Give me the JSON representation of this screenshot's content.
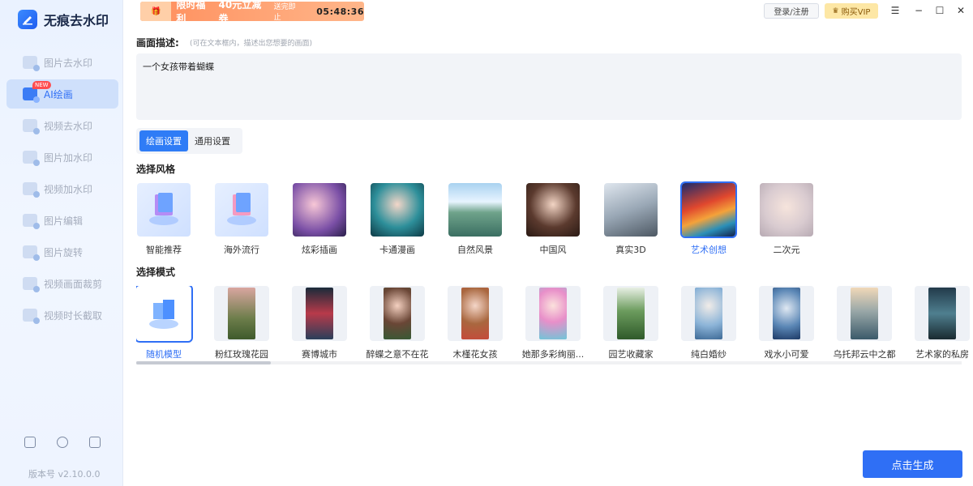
{
  "app": {
    "name": "无痕去水印",
    "version": "版本号 v2.10.0.0"
  },
  "sidebar": {
    "items": [
      {
        "label": "图片去水印",
        "active": false,
        "badge": ""
      },
      {
        "label": "AI绘画",
        "active": true,
        "badge": "NEW"
      },
      {
        "label": "视频去水印",
        "active": false,
        "badge": ""
      },
      {
        "label": "图片加水印",
        "active": false,
        "badge": ""
      },
      {
        "label": "视频加水印",
        "active": false,
        "badge": ""
      },
      {
        "label": "图片编辑",
        "active": false,
        "badge": ""
      },
      {
        "label": "图片旋转",
        "active": false,
        "badge": ""
      },
      {
        "label": "视频画面裁剪",
        "active": false,
        "badge": ""
      },
      {
        "label": "视频时长截取",
        "active": false,
        "badge": ""
      }
    ]
  },
  "titlebar": {
    "promo_title": "限时福利",
    "promo_amount": "40元立减券",
    "promo_sub": "送完即止",
    "promo_countdown": "05:48:36",
    "login_label": "登录/注册",
    "vip_label": "购买VIP"
  },
  "main": {
    "desc_label": "画面描述:",
    "desc_hint": "(可在文本框内，描述出您想要的画面)",
    "desc_value": "一个女孩带着蝴蝶",
    "tabs": [
      {
        "label": "绘画设置",
        "active": true
      },
      {
        "label": "通用设置",
        "active": false
      }
    ],
    "style_title": "选择风格",
    "styles": [
      {
        "label": "智能推荐",
        "selected": false
      },
      {
        "label": "海外流行",
        "selected": false
      },
      {
        "label": "炫彩插画",
        "selected": false
      },
      {
        "label": "卡通漫画",
        "selected": false
      },
      {
        "label": "自然风景",
        "selected": false
      },
      {
        "label": "中国风",
        "selected": false
      },
      {
        "label": "真实3D",
        "selected": false
      },
      {
        "label": "艺术创想",
        "selected": true
      },
      {
        "label": "二次元",
        "selected": false
      }
    ],
    "model_title": "选择模式",
    "models": [
      {
        "label": "随机模型",
        "selected": true
      },
      {
        "label": "粉红玫瑰花园",
        "selected": false
      },
      {
        "label": "赛博城市",
        "selected": false
      },
      {
        "label": "醉蝶之意不在花",
        "selected": false
      },
      {
        "label": "木槿花女孩",
        "selected": false
      },
      {
        "label": "她那多彩绚丽...",
        "selected": false
      },
      {
        "label": "园艺收藏家",
        "selected": false
      },
      {
        "label": "纯白婚纱",
        "selected": false
      },
      {
        "label": "戏水小可爱",
        "selected": false
      },
      {
        "label": "乌托邦云中之都",
        "selected": false
      },
      {
        "label": "艺术家的私房",
        "selected": false
      }
    ],
    "generate_label": "点击生成"
  },
  "colors": {
    "accent": "#2f6ff5",
    "promo": "#ff8e5c",
    "vip": "#fde7a5"
  }
}
